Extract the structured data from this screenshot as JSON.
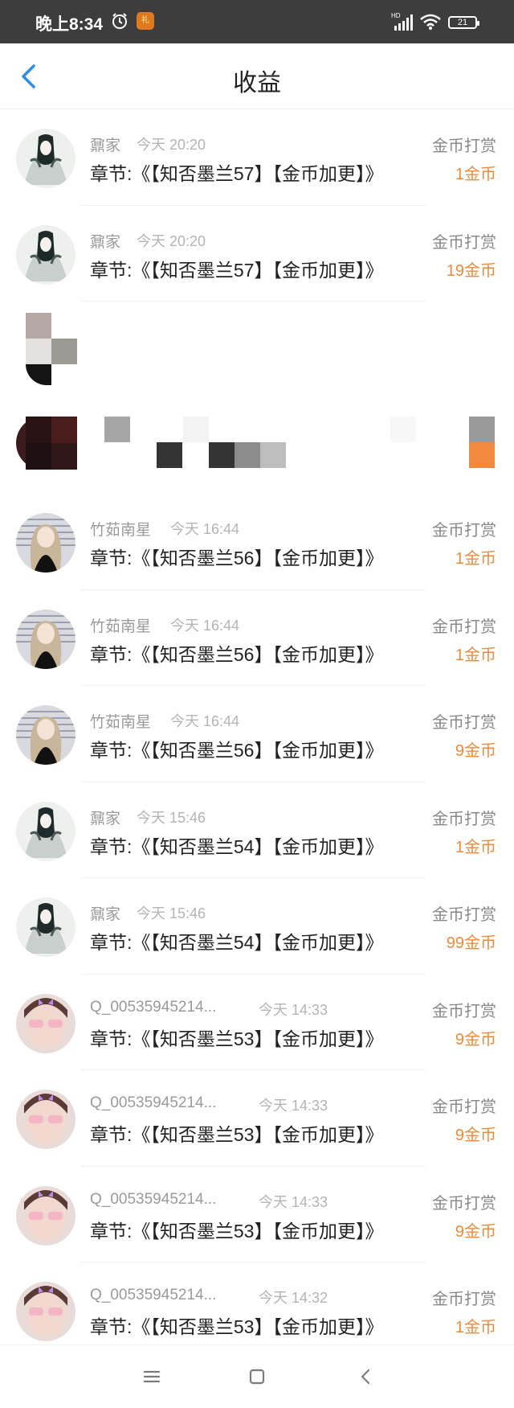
{
  "status_bar": {
    "time": "晚上8:34",
    "app_badge": "礼",
    "signal_label": "HD",
    "battery": "21"
  },
  "header": {
    "title": "收益"
  },
  "rows": [
    {
      "name": "鼐家",
      "time": "今天 20:20",
      "chapter": "章节:《【知否墨兰57】【金币加更】》",
      "type": "金币打赏",
      "amount": "1金币",
      "avatar": "ink"
    },
    {
      "name": "鼐家",
      "time": "今天 20:20",
      "chapter": "章节:《【知否墨兰57】【金币加更】》",
      "type": "金币打赏",
      "amount": "19金币",
      "avatar": "ink"
    },
    {
      "name": "",
      "time": "",
      "chapter": "",
      "type": "",
      "amount": "",
      "avatar": "pixel-a"
    },
    {
      "name": "",
      "time": "",
      "chapter": "",
      "type": "",
      "amount": "",
      "avatar": "pixel-b"
    },
    {
      "name": "竹茹南星",
      "time": "今天 16:44",
      "chapter": "章节:《【知否墨兰56】【金币加更】》",
      "type": "金币打赏",
      "amount": "1金币",
      "avatar": "girl"
    },
    {
      "name": "竹茹南星",
      "time": "今天 16:44",
      "chapter": "章节:《【知否墨兰56】【金币加更】》",
      "type": "金币打赏",
      "amount": "1金币",
      "avatar": "girl"
    },
    {
      "name": "竹茹南星",
      "time": "今天 16:44",
      "chapter": "章节:《【知否墨兰56】【金币加更】》",
      "type": "金币打赏",
      "amount": "9金币",
      "avatar": "girl"
    },
    {
      "name": "鼐家",
      "time": "今天 15:46",
      "chapter": "章节:《【知否墨兰54】【金币加更】》",
      "type": "金币打赏",
      "amount": "1金币",
      "avatar": "ink"
    },
    {
      "name": "鼐家",
      "time": "今天 15:46",
      "chapter": "章节:《【知否墨兰54】【金币加更】》",
      "type": "金币打赏",
      "amount": "99金币",
      "avatar": "ink"
    },
    {
      "name": "Q_00535945214...",
      "time": "今天 14:33",
      "chapter": "章节:《【知否墨兰53】【金币加更】》",
      "type": "金币打赏",
      "amount": "9金币",
      "avatar": "photo"
    },
    {
      "name": "Q_00535945214...",
      "time": "今天 14:33",
      "chapter": "章节:《【知否墨兰53】【金币加更】》",
      "type": "金币打赏",
      "amount": "9金币",
      "avatar": "photo"
    },
    {
      "name": "Q_00535945214...",
      "time": "今天 14:33",
      "chapter": "章节:《【知否墨兰53】【金币加更】》",
      "type": "金币打赏",
      "amount": "9金币",
      "avatar": "photo"
    },
    {
      "name": "Q_00535945214...",
      "time": "今天 14:32",
      "chapter": "章节:《【知否墨兰53】【金币加更】》",
      "type": "金币打赏",
      "amount": "1金币",
      "avatar": "photo"
    }
  ],
  "colors": {
    "status_bar_bg": "#3d3d3d",
    "back_arrow": "#2b8de8",
    "amount": "#f08a3a",
    "type_text": "#888888",
    "name_text": "#9a9a9a",
    "chapter_text": "#222222"
  },
  "icons": {
    "back": "chevron-left-icon",
    "menu": "menu-icon",
    "home": "home-square-icon",
    "nav_back": "nav-back-icon"
  }
}
